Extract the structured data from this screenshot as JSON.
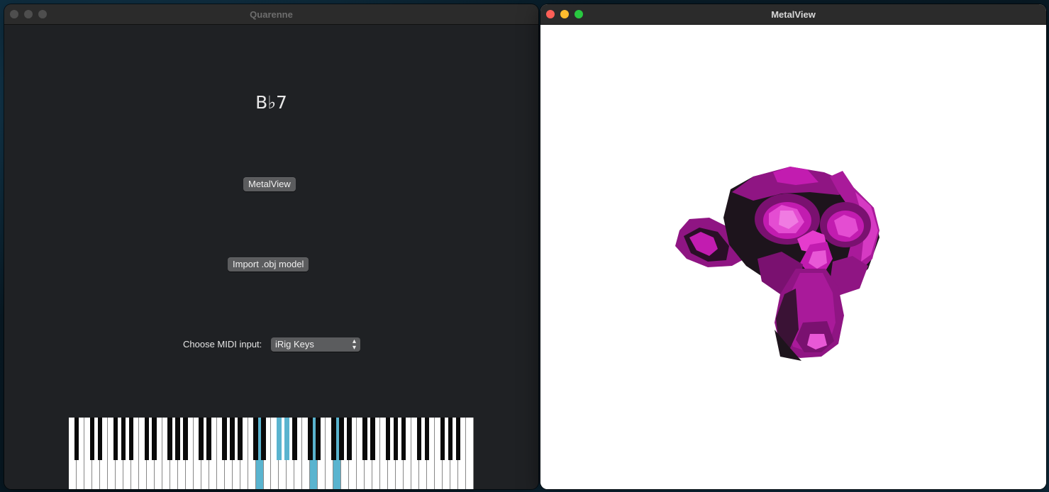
{
  "left_window": {
    "title": "Quarenne",
    "chord": "B♭7",
    "metal_button": "MetalView",
    "import_button": "Import .obj model",
    "midi_label": "Choose MIDI input:",
    "midi_value": "iRig Keys",
    "keyboard": {
      "white_keys": 52,
      "highlighted_white": [
        24,
        31,
        34
      ],
      "highlighted_black": [
        18,
        19
      ]
    },
    "highlight_color": "#5ab4cf"
  },
  "right_window": {
    "title": "MetalView",
    "model_color": "#c81fb4"
  }
}
